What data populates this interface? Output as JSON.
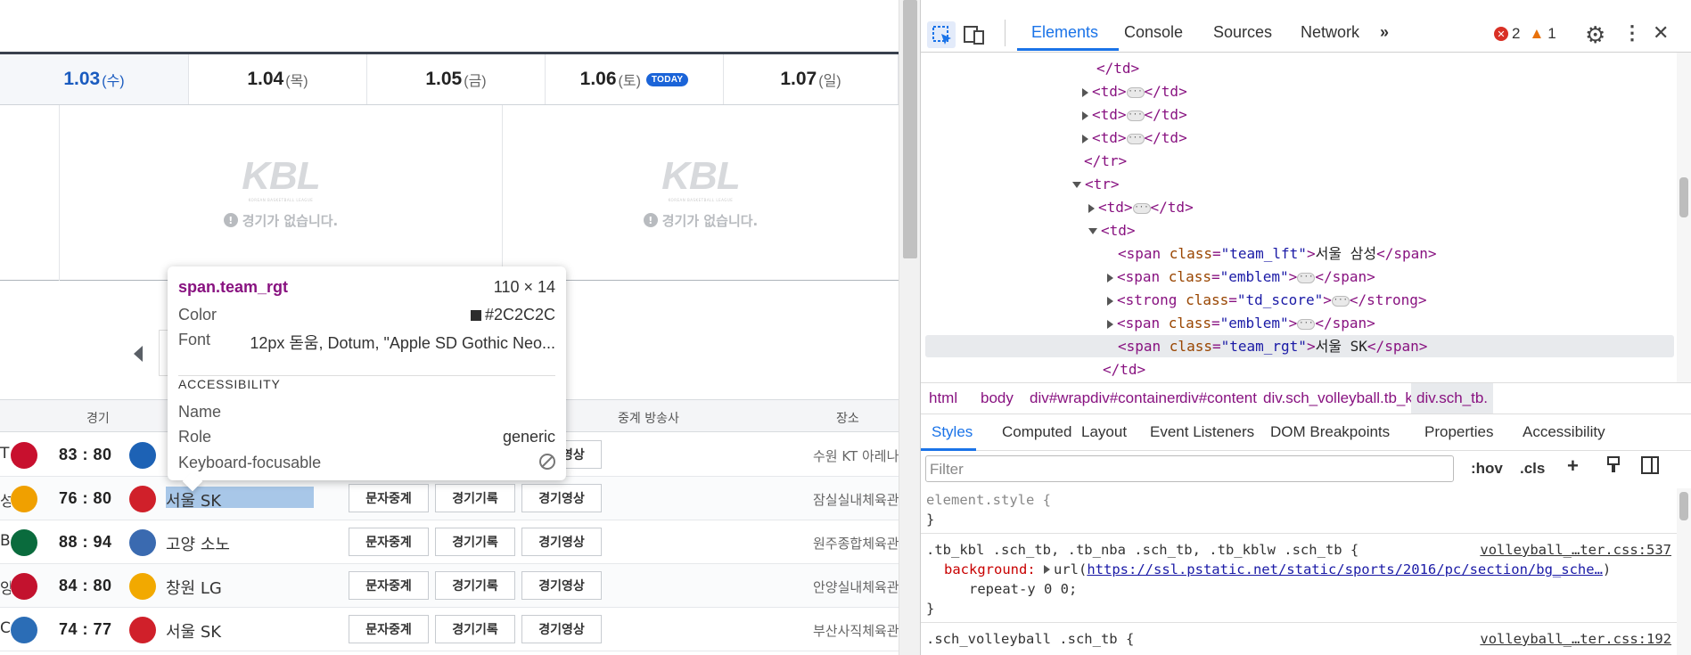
{
  "dates": [
    {
      "num": "1.03",
      "dow": "(수)",
      "active": true
    },
    {
      "num": "1.04",
      "dow": "(목)"
    },
    {
      "num": "1.05",
      "dow": "(금)"
    },
    {
      "num": "1.06",
      "dow": "(토)",
      "today": "TODAY"
    },
    {
      "num": "1.07",
      "dow": "(일)"
    }
  ],
  "empty_slots": {
    "logo": "KBL",
    "logo_sub": "KOREAN BASKETBALL LEAGUE",
    "message": "경기가 없습니다."
  },
  "table_header": {
    "game": "경기",
    "broadcaster": "중계 방송사",
    "venue": "장소"
  },
  "games": [
    {
      "left_team": "T",
      "score": "83 : 80",
      "right_team": "",
      "btn1": "",
      "btn2": "",
      "btn3": "경기영상",
      "venue": "수원 KT 아레나",
      "emb_l": "#c8102e",
      "emb_r": "#1d62b5"
    },
    {
      "left_team": "성",
      "score": "76 : 80",
      "right_team": "서울 SK",
      "btn1": "문자중계",
      "btn2": "경기기록",
      "btn3": "경기영상",
      "venue": "잠실실내체육관",
      "emb_l": "#f0a000",
      "emb_r": "#d0202a"
    },
    {
      "left_team": "B",
      "score": "88 : 94",
      "right_team": "고양 소노",
      "btn1": "문자중계",
      "btn2": "경기기록",
      "btn3": "경기영상",
      "venue": "원주종합체육관",
      "emb_l": "#0a6b3d",
      "emb_r": "#3a6ab0"
    },
    {
      "left_team": "양",
      "score": "84 : 80",
      "right_team": "창원 LG",
      "btn1": "문자중계",
      "btn2": "경기기록",
      "btn3": "경기영상",
      "venue": "안양실내체육관",
      "emb_l": "#c3122e",
      "emb_r": "#f2a900"
    },
    {
      "left_team": "C",
      "score": "74 : 77",
      "right_team": "서울 SK",
      "btn1": "문자중계",
      "btn2": "경기기록",
      "btn3": "경기영상",
      "venue": "부산사직체육관",
      "emb_l": "#2b6db6",
      "emb_r": "#d0202a"
    }
  ],
  "tooltip": {
    "selector": "span.team_rgt",
    "size": "110 × 14",
    "color_label": "Color",
    "color_value": "#2C2C2C",
    "font_label": "Font",
    "font_value": "12px 돋움, Dotum, \"Apple SD Gothic Neo...",
    "section": "ACCESSIBILITY",
    "name_label": "Name",
    "name_value": "",
    "role_label": "Role",
    "role_value": "generic",
    "kbd_label": "Keyboard-focusable"
  },
  "devtools": {
    "tabs": [
      "Elements",
      "Console",
      "Sources",
      "Network"
    ],
    "errors": "2",
    "warnings": "1",
    "dom": [
      {
        "ind": 0,
        "html": "</td>"
      },
      {
        "ind": 0,
        "exp": "r",
        "html": "<td>…</td>"
      },
      {
        "ind": 0,
        "exp": "r",
        "html": "<td>…</td>"
      },
      {
        "ind": 0,
        "exp": "r",
        "html": "<td>…</td>"
      },
      {
        "ind": -1,
        "html": "</tr>"
      },
      {
        "ind": -1,
        "exp": "d",
        "html": "<tr>"
      },
      {
        "ind": 0,
        "exp": "r",
        "html": "<td>…</td>"
      },
      {
        "ind": 0,
        "exp": "d",
        "html": "<td>"
      }
    ],
    "dom_lines": {
      "l1": "서울 삼성",
      "l3": "td_score",
      "l5": "서울 SK"
    },
    "breadcrumbs": [
      "html",
      "body",
      "div#wrap",
      "div#container",
      "div#content",
      "div.sch_volleyball.tb_kbl",
      "div.sch_tb."
    ],
    "subtabs": [
      "Styles",
      "Computed",
      "Layout",
      "Event Listeners",
      "DOM Breakpoints",
      "Properties",
      "Accessibility"
    ],
    "filter_placeholder": "Filter",
    "filter_opts": [
      ":hov",
      ".cls"
    ],
    "styles": {
      "element_style": "element.style {",
      "rule1_sel": ".tb_kbl .sch_tb, .tb_nba .sch_tb, .tb_kblw .sch_tb {",
      "rule1_src": "volleyball_…ter.css:537",
      "rule1_prop": "background:",
      "rule1_url": "https://ssl.pstatic.net/static/sports/2016/pc/section/bg_sche…",
      "rule1_rest": "repeat-y 0 0;",
      "rule2_sel": ".sch_volleyball .sch_tb {",
      "rule2_src": "volleyball_…ter.css:192"
    }
  }
}
